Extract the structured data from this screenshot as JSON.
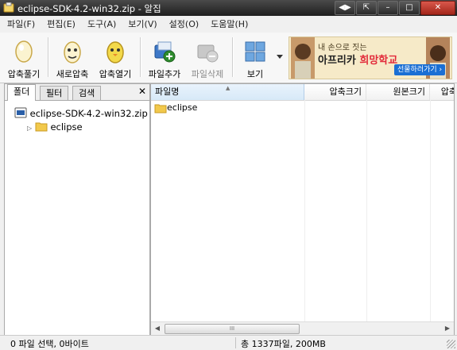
{
  "window": {
    "title": "eclipse-SDK-4.2-win32.zip - 알집",
    "buttons": [
      "◀▶",
      "⇱",
      "–",
      "□",
      "✕"
    ]
  },
  "menu": [
    "파일(F)",
    "편집(E)",
    "도구(A)",
    "보기(V)",
    "설정(O)",
    "도움말(H)"
  ],
  "toolbar": {
    "compress": "압축풀기",
    "new_archive": "새로압축",
    "open_archive": "압축열기",
    "add_file": "파일추가",
    "delete_file": "파일삭제",
    "view": "보기"
  },
  "banner": {
    "line1": "내 손으로 짓는",
    "line2a": "아프리카 ",
    "line2b": "희망학교",
    "cta": "선물하러가기 ›"
  },
  "left_pane": {
    "tabs": [
      "폴더",
      "필터",
      "검색"
    ],
    "close": "✕",
    "tree": {
      "root": "eclipse-SDK-4.2-win32.zip",
      "child": "eclipse"
    }
  },
  "file_list": {
    "columns": [
      "파일명",
      "압축크기",
      "원본크기",
      "압축"
    ],
    "rows": [
      {
        "name": "eclipse"
      }
    ],
    "scroll_grip": "III"
  },
  "status": {
    "left": "0 파일 선택,  0바이트",
    "right": "총 1337파일,  200MB"
  },
  "colors": {
    "titlebar": "#2a2a2a",
    "folder": "#f2c94c",
    "banner_bg": "#f6eac8",
    "banner_highlight": "#e22a3a",
    "cta": "#1a6fd4"
  }
}
